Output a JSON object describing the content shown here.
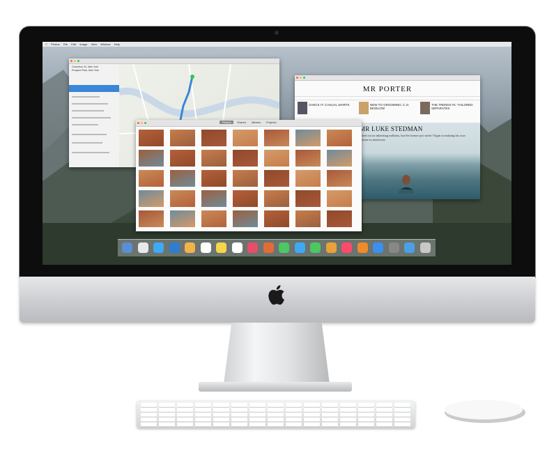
{
  "screen": {
    "menubar": {
      "items": [
        "Photos",
        "File",
        "Edit",
        "Image",
        "View",
        "Window",
        "Help"
      ]
    }
  },
  "maps": {
    "start": "Columbus Cir, New York",
    "end": "Prospect Park, New York"
  },
  "porter": {
    "logo": "MR PORTER",
    "hero_title": "MR LUKE STEDMAN",
    "hero_sub": "mbed out on inheriting millions, but the former pro surfer Virgin on making his own fortune in menswear",
    "promo_1": "CHECK IT: CASUAL SHIRTS",
    "promo_2": "NEW TO GROOMING: C.O. BIGELOW",
    "promo_3": "THE TRENDS #1: TAILORED SEPARATES"
  },
  "photos": {
    "tabs": [
      "Photos",
      "Shared",
      "Albums",
      "Projects"
    ]
  },
  "colors": {
    "dock_tint": "#dce2e6",
    "maps_route": "#3a86d8",
    "brand_porter": "#111111"
  }
}
